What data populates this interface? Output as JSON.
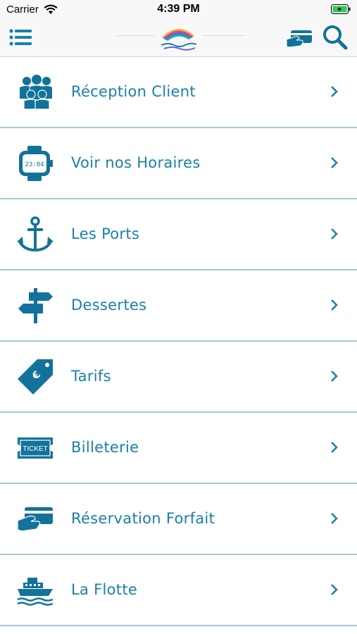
{
  "status_bar": {
    "carrier": "Carrier",
    "time": "4:39 PM"
  },
  "nav": {
    "logo_alt": "Vedettes Tropicales"
  },
  "colors": {
    "accent": "#1a7fa8",
    "icon": "#13729a",
    "divider": "#a9c8d6"
  },
  "menu": {
    "items": [
      {
        "label": "Réception Client",
        "icon": "people-icon"
      },
      {
        "label": "Voir nos Horaires",
        "icon": "watch-icon",
        "icon_text": "23:04"
      },
      {
        "label": "Les Ports",
        "icon": "anchor-icon"
      },
      {
        "label": "Dessertes",
        "icon": "signpost-icon"
      },
      {
        "label": "Tarifs",
        "icon": "price-tag-icon",
        "icon_text": "€"
      },
      {
        "label": "Billeterie",
        "icon": "ticket-icon",
        "icon_text": "TICKET"
      },
      {
        "label": "Réservation Forfait",
        "icon": "card-payment-icon"
      },
      {
        "label": "La Flotte",
        "icon": "ship-icon"
      }
    ]
  }
}
